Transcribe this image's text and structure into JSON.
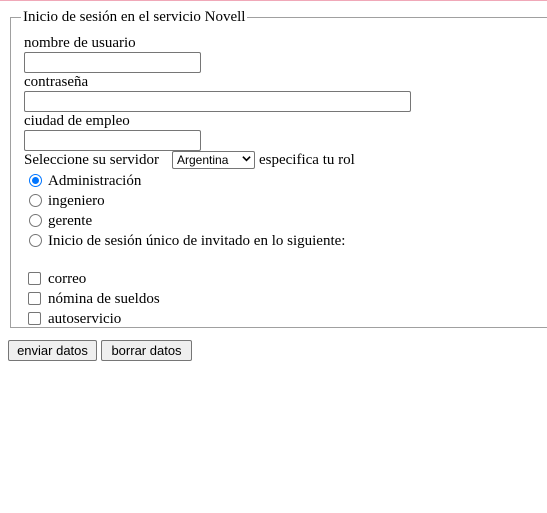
{
  "form": {
    "legend": "Inicio de sesión en el servicio Novell",
    "username_label": "nombre de usuario",
    "username_value": "",
    "password_label": "contraseña",
    "password_value": "",
    "city_label": "ciudad de empleo",
    "city_value": "",
    "server_label": "Seleccione su servidor",
    "server_selected": "Argentina",
    "role_label": "especifica tu rol",
    "roles": [
      {
        "label": "Administración",
        "checked": true
      },
      {
        "label": "ingeniero",
        "checked": false
      },
      {
        "label": "gerente",
        "checked": false
      },
      {
        "label": "Inicio de sesión único de invitado en lo siguiente:",
        "checked": false
      }
    ],
    "services": [
      {
        "label": "correo",
        "checked": false
      },
      {
        "label": "nómina de sueldos",
        "checked": false
      },
      {
        "label": "autoservicio",
        "checked": false
      }
    ],
    "submit_label": "enviar datos",
    "reset_label": "borrar datos"
  },
  "colors": {
    "accent": "#0075ff",
    "border": "#767676",
    "fieldset_border": "#a0a0a0",
    "button_bg": "#efefef",
    "top_line": "#f0a8b8"
  },
  "icons": {
    "select_arrow": "chevron-down-icon"
  }
}
